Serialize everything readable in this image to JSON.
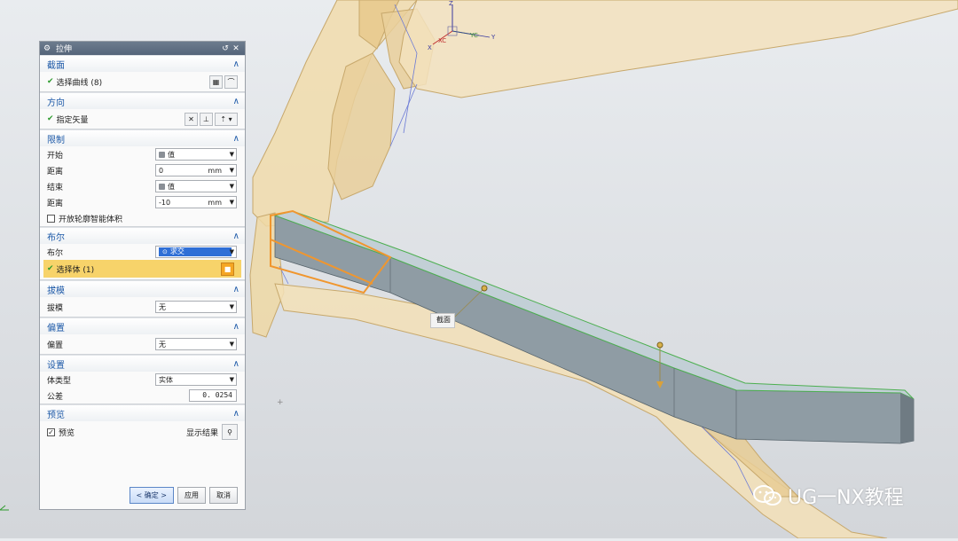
{
  "dialog": {
    "title": "拉伸",
    "sections": {
      "section": {
        "header": "截面",
        "select_curve": "选择曲线 (8)"
      },
      "direction": {
        "header": "方向",
        "specify_vector": "指定矢量"
      },
      "limits": {
        "header": "限制",
        "start_label": "开始",
        "start_value": "值",
        "distance1_label": "距离",
        "distance1_value": "0",
        "distance1_unit": "mm",
        "end_label": "结束",
        "end_value": "值",
        "distance2_label": "距离",
        "distance2_value": "-10",
        "distance2_unit": "mm",
        "open_profile": "开放轮廓智能体积"
      },
      "boolean": {
        "header": "布尔",
        "boolean_label": "布尔",
        "boolean_value": "求交",
        "select_body": "选择体 (1)"
      },
      "draft": {
        "header": "拔模",
        "draft_label": "拔模",
        "draft_value": "无"
      },
      "offset": {
        "header": "偏置",
        "offset_label": "偏置",
        "offset_value": "无"
      },
      "settings": {
        "header": "设置",
        "body_type_label": "体类型",
        "body_type_value": "实体",
        "tolerance_label": "公差",
        "tolerance_value": "0. 0254"
      },
      "preview": {
        "header": "预览",
        "preview_label": "预览",
        "show_result": "显示结果"
      }
    },
    "buttons": {
      "ok": "< 确定 >",
      "apply": "应用",
      "cancel": "取消"
    }
  },
  "viewport": {
    "section_tag": "截面",
    "triad": {
      "xc": "XC",
      "yc": "YC",
      "y": "Y",
      "x": "X",
      "z": "Z"
    }
  },
  "watermark": "UG一NX教程",
  "colors": {
    "title_bar": "#5f6f83",
    "section_header_text": "#1e5aa8",
    "selected_row": "#f7d36a",
    "body_frame": "#f0d9a8",
    "extrude_body": "#8e9ba3",
    "extrude_edge": "#4caf50",
    "section_curve": "#f0962e"
  }
}
